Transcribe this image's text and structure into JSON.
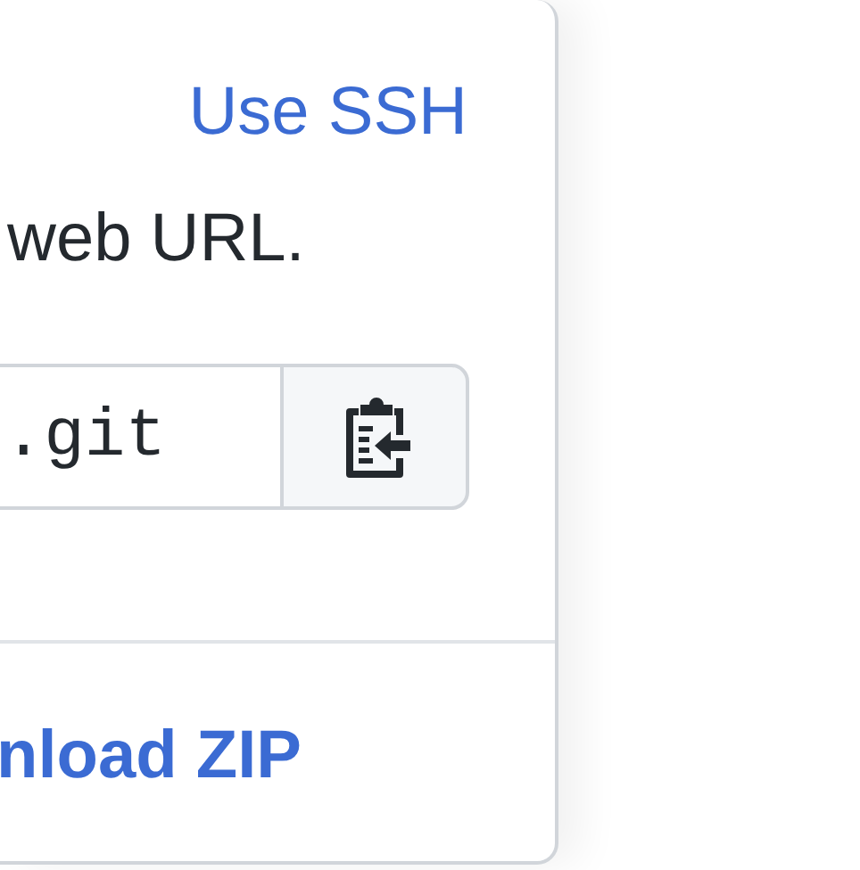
{
  "clone_panel": {
    "protocol_link": "Use SSH",
    "description": "web URL.",
    "url_field": {
      "value": ".git"
    },
    "download_link": "nload ZIP"
  }
}
